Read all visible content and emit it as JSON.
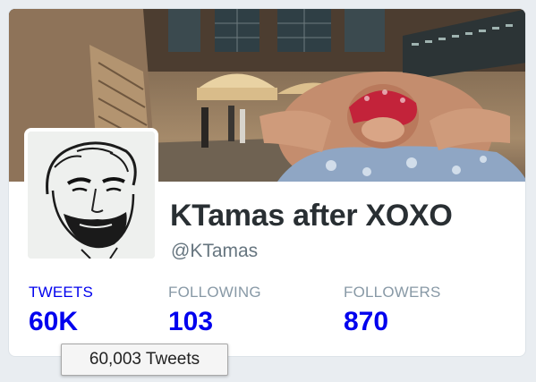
{
  "profile": {
    "name": "KTamas after XOXO",
    "handle": "@KTamas"
  },
  "stats": [
    {
      "label": "TWEETS",
      "value": "60K"
    },
    {
      "label": "FOLLOWING",
      "value": "103"
    },
    {
      "label": "FOLLOWERS",
      "value": "870"
    }
  ],
  "tooltip": {
    "text": "60,003 Tweets"
  },
  "colors": {
    "link": "#0000ee",
    "label_muted": "#8899a6",
    "name": "#292f33",
    "handle": "#66757f"
  },
  "images": {
    "banner": "station-hall-photo",
    "avatar": "sketch-portrait"
  }
}
